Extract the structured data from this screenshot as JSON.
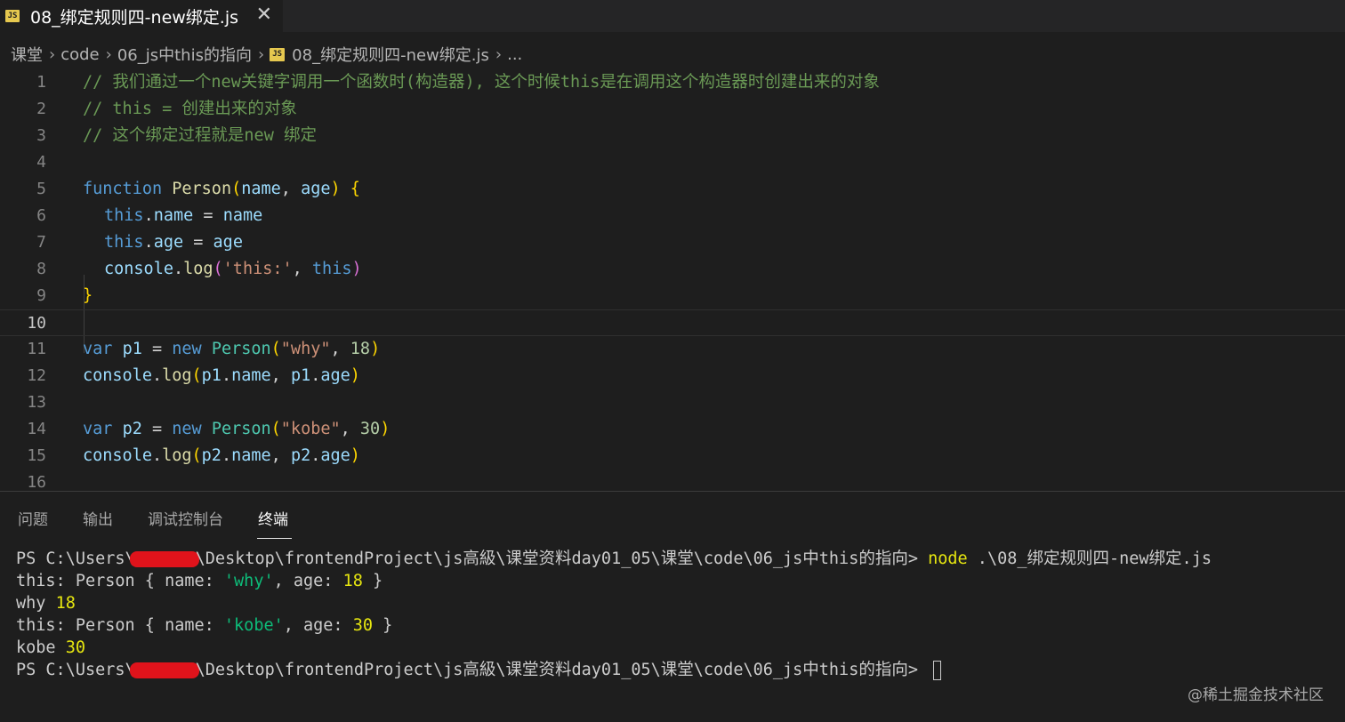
{
  "tab": {
    "badge": "JS",
    "title": "08_绑定规则四-new绑定.js",
    "close": "✕"
  },
  "breadcrumb": {
    "items": [
      "课堂",
      "code",
      "06_js中this的指向",
      "08_绑定规则四-new绑定.js",
      "..."
    ],
    "sep": "›",
    "file_badge": "JS"
  },
  "editor": {
    "line_numbers": [
      "1",
      "2",
      "3",
      "4",
      "5",
      "6",
      "7",
      "8",
      "9",
      "10",
      "11",
      "12",
      "13",
      "14",
      "15",
      "16"
    ],
    "current_line": "10",
    "lines": {
      "l1": "// 我们通过一个new关键字调用一个函数时(构造器), 这个时候this是在调用这个构造器时创建出来的对象",
      "l2": "// this = 创建出来的对象",
      "l3": "// 这个绑定过程就是new 绑定",
      "l5": {
        "kw": "function",
        "fn": "Person",
        "lp": "(",
        "p1": "name",
        "comma": ", ",
        "p2": "age",
        "rp": ")",
        "sp": " ",
        "lb": "{"
      },
      "l6": {
        "kw": "this",
        "dot": ".",
        "prop": "name",
        "eq": " = ",
        "val": "name"
      },
      "l7": {
        "kw": "this",
        "dot": ".",
        "prop": "age",
        "eq": " = ",
        "val": "age"
      },
      "l8": {
        "obj": "console",
        "dot": ".",
        "fn": "log",
        "lp": "(",
        "str": "'this:'",
        "comma": ", ",
        "kw": "this",
        "rp": ")"
      },
      "l9": {
        "rb": "}"
      },
      "l11": {
        "kw": "var",
        "var": "p1",
        "eq": " = ",
        "new": "new",
        "cls": "Person",
        "lp": "(",
        "str": "\"why\"",
        "comma": ", ",
        "num": "18",
        "rp": ")"
      },
      "l12": {
        "obj": "console",
        "dot": ".",
        "fn": "log",
        "lp": "(",
        "a1": "p1",
        "d1": ".",
        "pr1": "name",
        "comma": ", ",
        "a2": "p1",
        "d2": ".",
        "pr2": "age",
        "rp": ")"
      },
      "l14": {
        "kw": "var",
        "var": "p2",
        "eq": " = ",
        "new": "new",
        "cls": "Person",
        "lp": "(",
        "str": "\"kobe\"",
        "comma": ", ",
        "num": "30",
        "rp": ")"
      },
      "l15": {
        "obj": "console",
        "dot": ".",
        "fn": "log",
        "lp": "(",
        "a1": "p2",
        "d1": ".",
        "pr1": "name",
        "comma": ", ",
        "a2": "p2",
        "d2": ".",
        "pr2": "age",
        "rp": ")"
      }
    }
  },
  "panel": {
    "tabs": [
      "问题",
      "输出",
      "调试控制台",
      "终端"
    ],
    "active_tab": "终端"
  },
  "terminal": {
    "prompt_a": "PS C:\\Users\\",
    "prompt_b": "\\Desktop\\frontendProject\\js高級\\课堂资料day01_05\\课堂\\code\\06_js中this的指向> ",
    "cmd": "node",
    "cmd_arg": " .\\08_绑定规则四-new绑定.js",
    "out1": {
      "a": "this: Person { name: ",
      "s": "'why'",
      "b": ", age: ",
      "n": "18",
      "c": " }"
    },
    "out2": {
      "a": "why ",
      "n": "18"
    },
    "out3": {
      "a": "this: Person { name: ",
      "s": "'kobe'",
      "b": ", age: ",
      "n": "30",
      "c": " }"
    },
    "out4": {
      "a": "kobe ",
      "n": "30"
    }
  },
  "watermark": "@稀土掘金技术社区"
}
